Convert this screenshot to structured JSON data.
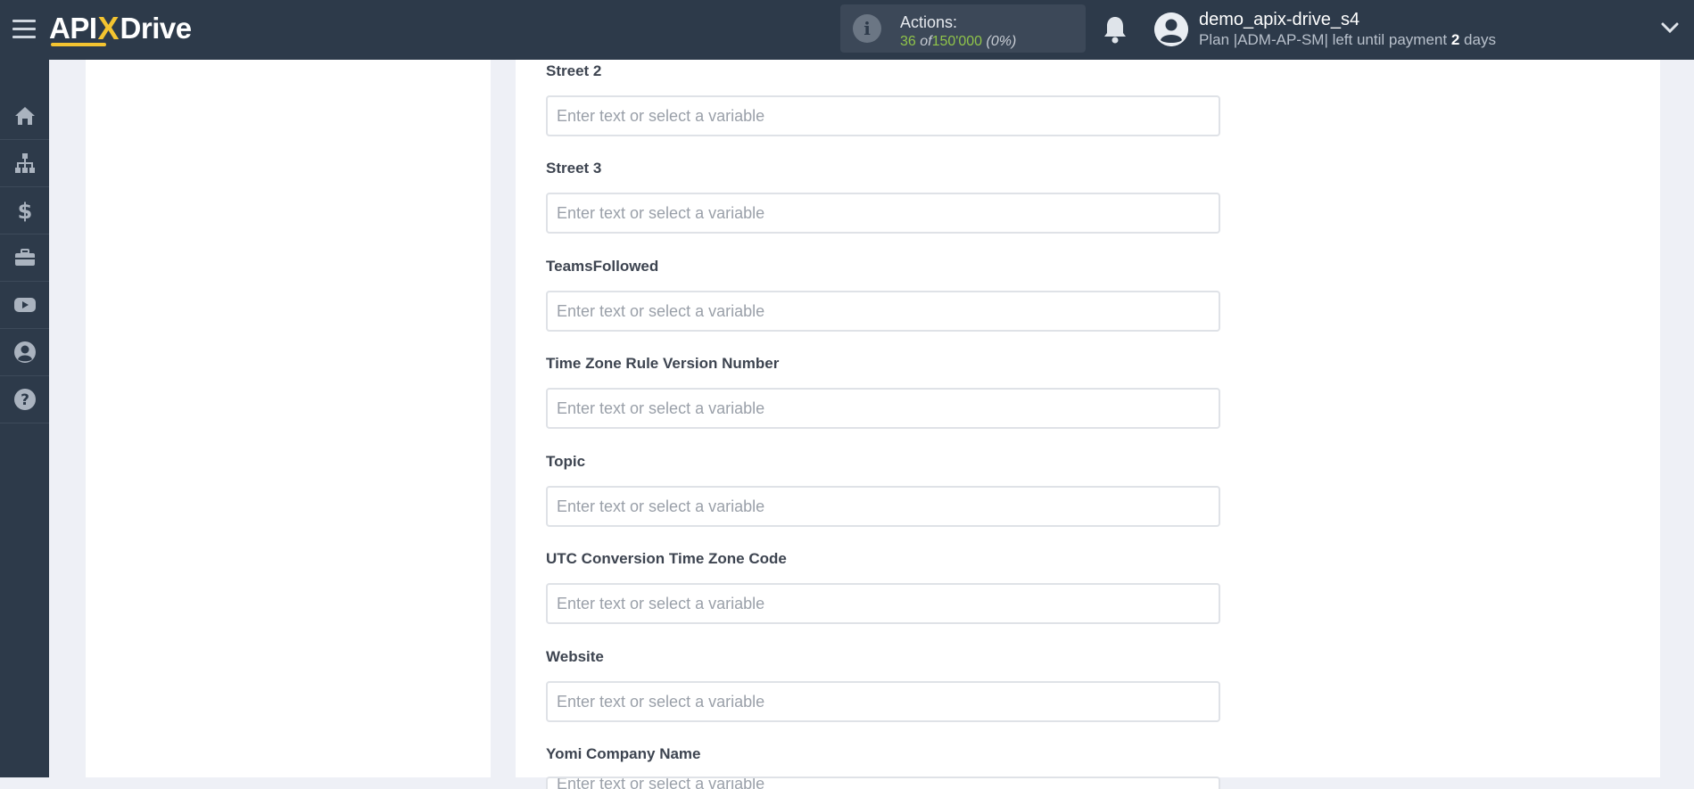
{
  "header": {
    "logo": {
      "api": "API",
      "x": "X",
      "drive": "Drive"
    },
    "actions": {
      "label": "Actions:",
      "used": "36",
      "of": "of",
      "total": "150'000",
      "percent": "(0%)"
    },
    "user": {
      "name": "demo_apix-drive_s4",
      "plan_prefix": "Plan |ADM-AP-SM| left until payment",
      "days_value": "2",
      "days_unit": "days"
    }
  },
  "sidebar": {
    "items": [
      {
        "icon": "home-icon"
      },
      {
        "icon": "sitemap-icon"
      },
      {
        "icon": "dollar-icon"
      },
      {
        "icon": "briefcase-icon"
      },
      {
        "icon": "youtube-icon"
      },
      {
        "icon": "user-circle-icon"
      },
      {
        "icon": "question-circle-icon"
      }
    ]
  },
  "form": {
    "placeholder": "Enter text or select a variable",
    "fields": [
      {
        "label": "Street 2"
      },
      {
        "label": "Street 3"
      },
      {
        "label": "TeamsFollowed"
      },
      {
        "label": "Time Zone Rule Version Number"
      },
      {
        "label": "Topic"
      },
      {
        "label": "UTC Conversion Time Zone Code"
      },
      {
        "label": "Website"
      },
      {
        "label": "Yomi Company Name"
      }
    ]
  },
  "colors": {
    "topbar": "#2d3a4a",
    "accent_yellow": "#f4c430",
    "actions_green": "#8fc34a",
    "page_bg": "#eef0f6"
  }
}
